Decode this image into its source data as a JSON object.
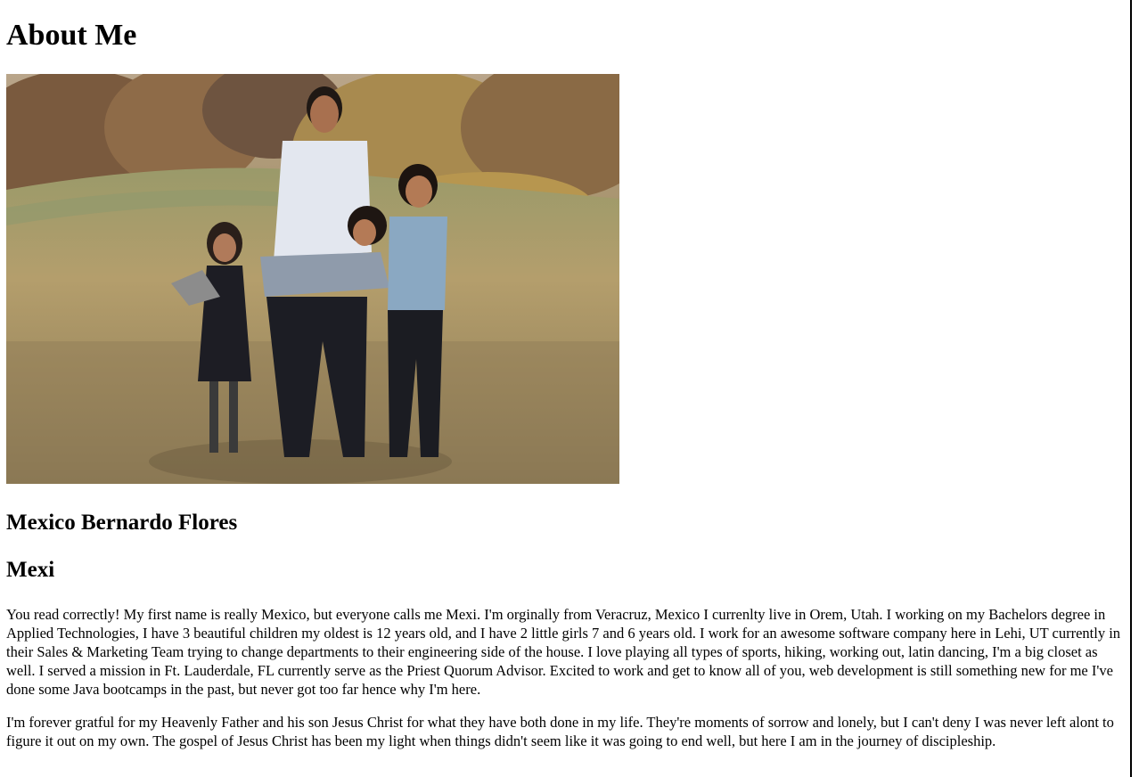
{
  "page": {
    "heading": "About Me",
    "photo_alt": "Family photo in a meadow",
    "full_name": "Mexico Bernardo Flores",
    "nickname": "Mexi",
    "paragraphs": [
      "You read correctly! My first name is really Mexico, but everyone calls me Mexi. I'm orginally from Veracruz, Mexico I currenlty live in Orem, Utah. I working on my Bachelors degree in Applied Technologies, I have 3 beautiful children my oldest is 12 years old, and I have 2 little girls 7 and 6 years old. I work for an awesome software company here in Lehi, UT currently in their Sales & Marketing Team trying to change departments to their engineering side of the house. I love playing all types of sports, hiking, working out, latin dancing, I'm a big closet as well. I served a mission in Ft. Lauderdale, FL currently serve as the Priest Quorum Advisor. Excited to work and get to know all of you, web development is still something new for me I've done some Java bootcamps in the past, but never got too far hence why I'm here.",
      "I'm forever gratful for my Heavenly Father and his son Jesus Christ for what they have both done in my life. They're moments of sorrow and lonely, but I can't deny I was never left alont to figure it out on my own. The gospel of Jesus Christ has been my light when things didn't seem like it was going to end well, but here I am in the journey of discipleship."
    ]
  },
  "colors": {
    "text": "#000000",
    "background": "#ffffff"
  }
}
